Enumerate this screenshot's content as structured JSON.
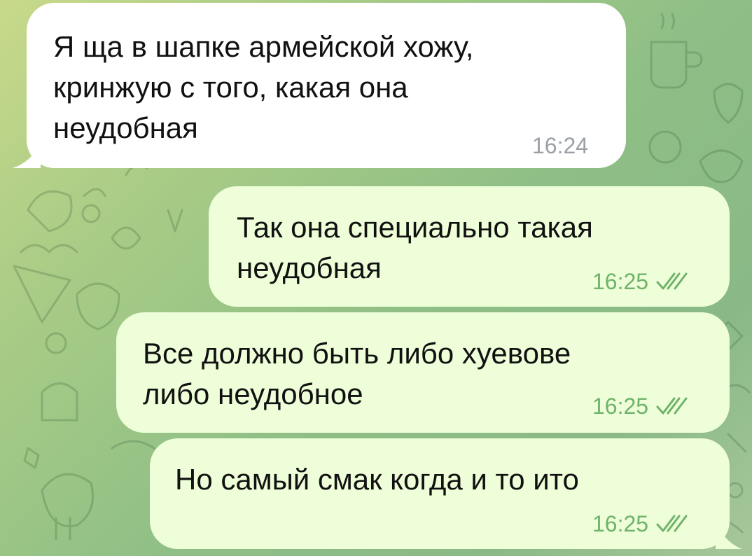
{
  "colors": {
    "incoming_bubble": "#ffffff",
    "outgoing_bubble": "#eefed8",
    "incoming_time": "#9aa0a6",
    "outgoing_time": "#6fb36a",
    "text": "#111111"
  },
  "messages": [
    {
      "direction": "incoming",
      "text": "Я ща в шапке армейской хожу,\nкринжую с того, какая она\nнеудобная",
      "time": "16:24",
      "read": false
    },
    {
      "direction": "outgoing",
      "text": "Так она специально такая\nнеудобная",
      "time": "16:25",
      "read": true
    },
    {
      "direction": "outgoing",
      "text": "Все должно быть либо хуевове\nлибо неудобное",
      "time": "16:25",
      "read": true
    },
    {
      "direction": "outgoing",
      "text": "Но самый смак когда и то ито",
      "time": "16:25",
      "read": true
    }
  ]
}
